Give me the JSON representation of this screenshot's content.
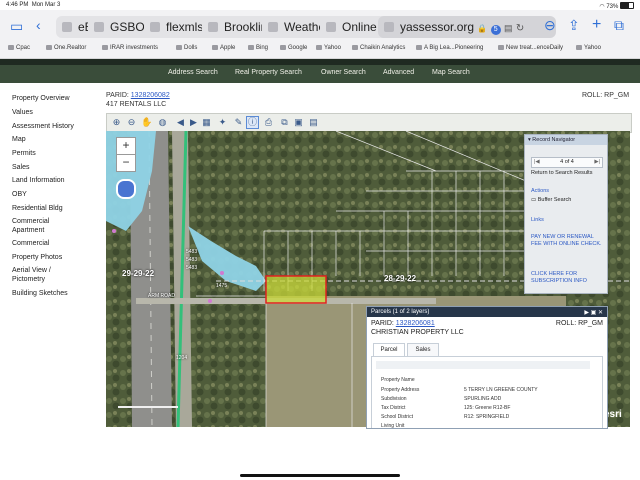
{
  "status_bar": {
    "time": "4:46 PM",
    "date": "Mon Mar 3",
    "battery": "73%"
  },
  "browser": {
    "tabs": [
      {
        "label": "eB"
      },
      {
        "label": "GSBOR"
      },
      {
        "label": "flexmls"
      },
      {
        "label": "Brooklin"
      },
      {
        "label": "Weathe"
      },
      {
        "label": "Online"
      }
    ],
    "address": "yassessor.org",
    "address_badge": "5",
    "bookmarks": [
      "Cpac",
      "One.Realtor",
      "IRAR investments",
      "Dolls",
      "Apple",
      "Bing",
      "Google",
      "Yahoo",
      "Chaikin Analytics",
      "A Big Lea...Pioneering",
      "New treat...enceDaily",
      "Yahoo"
    ]
  },
  "site_nav": {
    "items": [
      "Address Search",
      "Real Property Search",
      "Owner Search",
      "Advanced",
      "Map Search"
    ]
  },
  "sidebar": {
    "items": [
      "Property Overview",
      "Values",
      "Assessment History",
      "Map",
      "Permits",
      "Sales",
      "Land Information",
      "OBY",
      "Residential Bldg",
      "Commercial Apartment",
      "Commercial",
      "Property Photos",
      "Aerial View / Pictometry",
      "Building Sketches"
    ],
    "active": "Map"
  },
  "header": {
    "parid_label": "PARID:",
    "parid": "1328206082",
    "roll": "ROLL: RP_GM",
    "owner": "417 RENTALS LLC"
  },
  "map": {
    "zoom_in": "+",
    "zoom_out": "−",
    "labels": [
      "29-29-22",
      "28-29-22",
      "ARM ROAD",
      "1204",
      "1475",
      "5483",
      "5483",
      "5483"
    ],
    "attribution": "esri"
  },
  "record_navigator": {
    "title": "Record Navigator",
    "counter": "4 of 4",
    "return": "Return to Search Results",
    "actions_title": "Actions",
    "buffer": "Buffer Search",
    "links_title": "Links",
    "link1": "PAY NEW OR RENEWAL FEE WITH ONLINE CHECK.",
    "link2": "CLICK HERE FOR SUBSCRIPTION INFO"
  },
  "parcels_popup": {
    "title": "Parcels (1 of 2 layers)",
    "parid_label": "PARID:",
    "parid": "1328206081",
    "roll": "ROLL: RP_GM",
    "owner": "CHRISTIAN PROPERTY LLC",
    "tabs": [
      "Parcel",
      "Sales"
    ],
    "rows": [
      {
        "label": "Property Name",
        "value": ""
      },
      {
        "label": "Property Address",
        "value": "5 TERRY LN     GREENE COUNTY"
      },
      {
        "label": "Subdivision",
        "value": "SPURLING ADD"
      },
      {
        "label": "Tax District",
        "value": "125: Greene R12-BF"
      },
      {
        "label": "School District",
        "value": "R12: SPRINGFIELD"
      },
      {
        "label": "Living Unit",
        "value": ""
      }
    ]
  }
}
